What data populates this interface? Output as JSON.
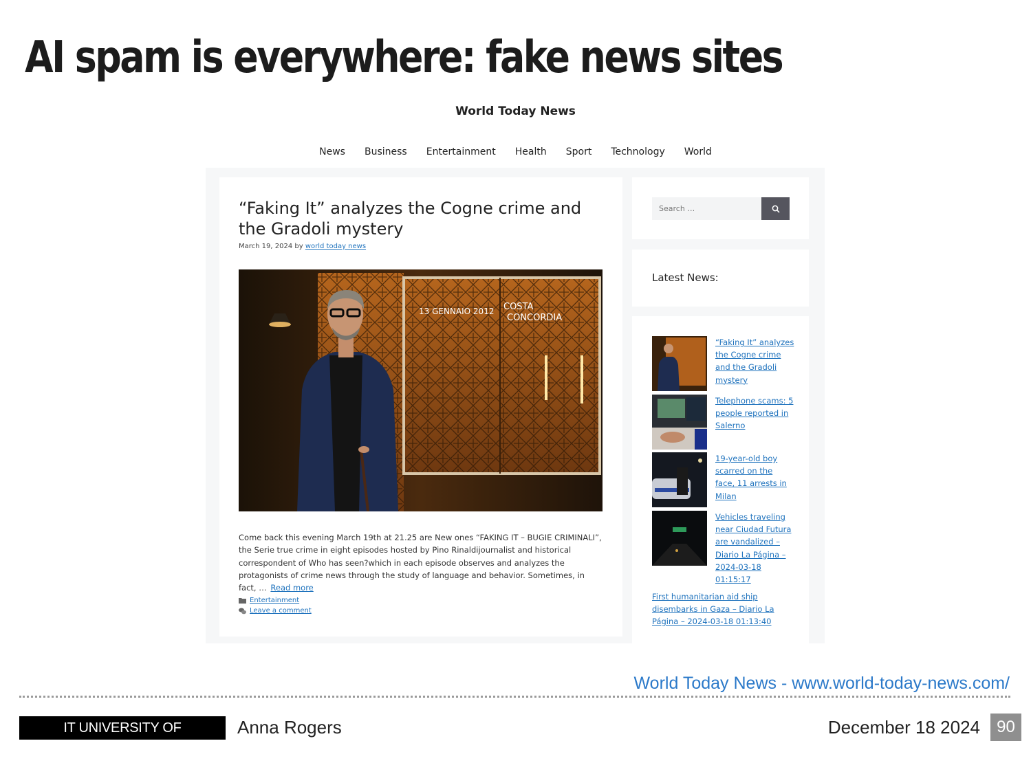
{
  "slide": {
    "title": "AI spam is everywhere: fake news sites",
    "source_link": "World Today News - www.world-today-news.com/",
    "footer": {
      "institution": "IT UNIVERSITY OF COPENHAGEN",
      "author": "Anna Rogers",
      "date": "December 18 2024",
      "page_number": "90"
    }
  },
  "site": {
    "name": "World Today News",
    "nav": [
      "News",
      "Business",
      "Entertainment",
      "Health",
      "Sport",
      "Technology",
      "World"
    ],
    "article": {
      "title": "“Faking It” analyzes the Cogne crime and the Gradoli mystery",
      "date": "March 19, 2024",
      "by": "by",
      "author": "world today news",
      "image_text": [
        "13 GENNAIO 2012",
        "COSTA",
        "CONCORDIA"
      ],
      "excerpt": "Come back this evening March 19th at 21.25 are New ones “FAKING IT – BUGIE CRIMINALI”, the Serie true crime in eight episodes hosted by Pino Rinaldijournalist and historical correspondent of Who has seen?which in each episode observes and analyzes the protagonists of crime news through the study of language and behavior. Sometimes, in fact, …",
      "read_more": "Read more",
      "category": "Entertainment",
      "comment_link": "Leave a comment"
    },
    "sidebar": {
      "search_placeholder": "Search …",
      "latest_title": "Latest News:",
      "items": [
        "“Faking It” analyzes the Cogne crime and the Gradoli mystery",
        "Telephone scams: 5 people reported in Salerno",
        "19-year-old boy scarred on the face, 11 arrests in Milan",
        "Vehicles traveling near Ciudad Futura are vandalized – Diario La Página – 2024-03-18 01:15:17",
        "First humanitarian aid ship disembarks in Gaza – Diario La Página – 2024-03-18 01:13:40"
      ]
    }
  },
  "icons": {
    "search": "magnifier-icon",
    "category": "folder-icon",
    "comment": "comments-icon"
  },
  "colors": {
    "link": "#1e72bd",
    "source_link": "#2b79c9",
    "search_button": "#55555e",
    "page_number_bg": "#8f8f8f"
  }
}
